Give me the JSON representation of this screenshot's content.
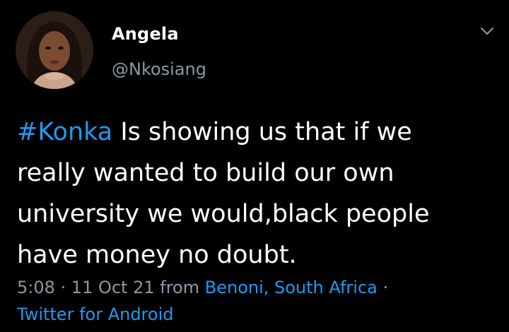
{
  "user": {
    "name": "Angela",
    "handle": "@Nkosiang",
    "avatar_icon": "user-avatar-photo"
  },
  "tweet": {
    "hashtag": "#Konka",
    "line1_rest": " Is showing us that if we",
    "line2": "really wanted to build our own",
    "line3": "university we would,black people",
    "line4": "have money no doubt."
  },
  "meta": {
    "time": "5:08",
    "separator": " · ",
    "date": "11 Oct 21",
    "from_word": " from ",
    "location": "Benoni, South Africa",
    "trailing_dot": " ·",
    "source": "Twitter for Android"
  },
  "icons": {
    "menu": "chevron-down-icon"
  },
  "colors": {
    "background": "#000000",
    "text": "#ffffff",
    "secondary": "#8b98a5",
    "accent": "#1d9bf0"
  }
}
